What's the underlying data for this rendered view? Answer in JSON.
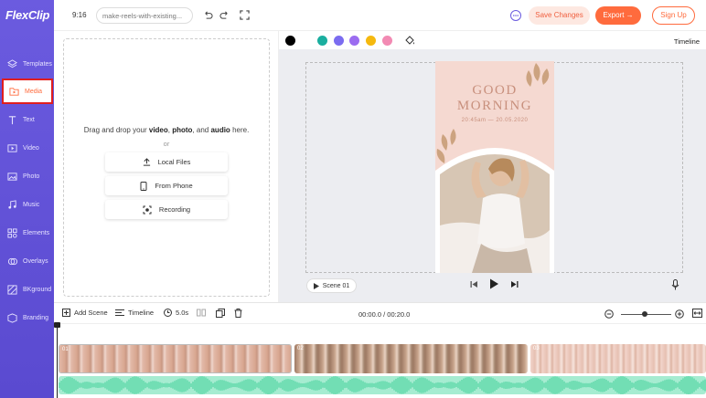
{
  "app": {
    "logo": "FlexClip"
  },
  "sidebar": {
    "items": [
      {
        "label": "Templates",
        "icon": "layers-icon"
      },
      {
        "label": "Media",
        "icon": "folder-icon",
        "active": true
      },
      {
        "label": "Text",
        "icon": "text-icon"
      },
      {
        "label": "Video",
        "icon": "video-icon"
      },
      {
        "label": "Photo",
        "icon": "photo-icon"
      },
      {
        "label": "Music",
        "icon": "music-icon"
      },
      {
        "label": "Elements",
        "icon": "elements-icon"
      },
      {
        "label": "Overlays",
        "icon": "overlays-icon"
      },
      {
        "label": "BKground",
        "icon": "background-icon"
      },
      {
        "label": "Branding",
        "icon": "branding-icon"
      }
    ]
  },
  "topbar": {
    "ratio": "9:16",
    "project_name": "make-reels-with-existing...",
    "save_label": "Save Changes",
    "export_label": "Export →",
    "signup_label": "Sign Up"
  },
  "media": {
    "drop_prefix": "Drag and drop your",
    "drop_video": "video",
    "drop_photo": "photo",
    "drop_and": ", and",
    "drop_audio": "audio",
    "drop_suffix": "here.",
    "or": "or",
    "local_files": "Local Files",
    "from_phone": "From Phone",
    "recording": "Recording"
  },
  "editor": {
    "colors": [
      "#000000",
      "#1aae9f",
      "#7b6cf0",
      "#9b6cf0",
      "#f5b90f",
      "#f28ab3"
    ],
    "timeline_label": "Timeline",
    "scene_label": "Scene 01",
    "poster_line1": "GOOD",
    "poster_line2": "MORNING",
    "poster_date": "20:45am — 20.05.2020"
  },
  "timeline": {
    "add_scene": "Add Scene",
    "timeline": "Timeline",
    "duration": "5.0s",
    "time": "00:00.0 / 00:20.0",
    "clips": [
      "01",
      "02",
      "03"
    ]
  }
}
